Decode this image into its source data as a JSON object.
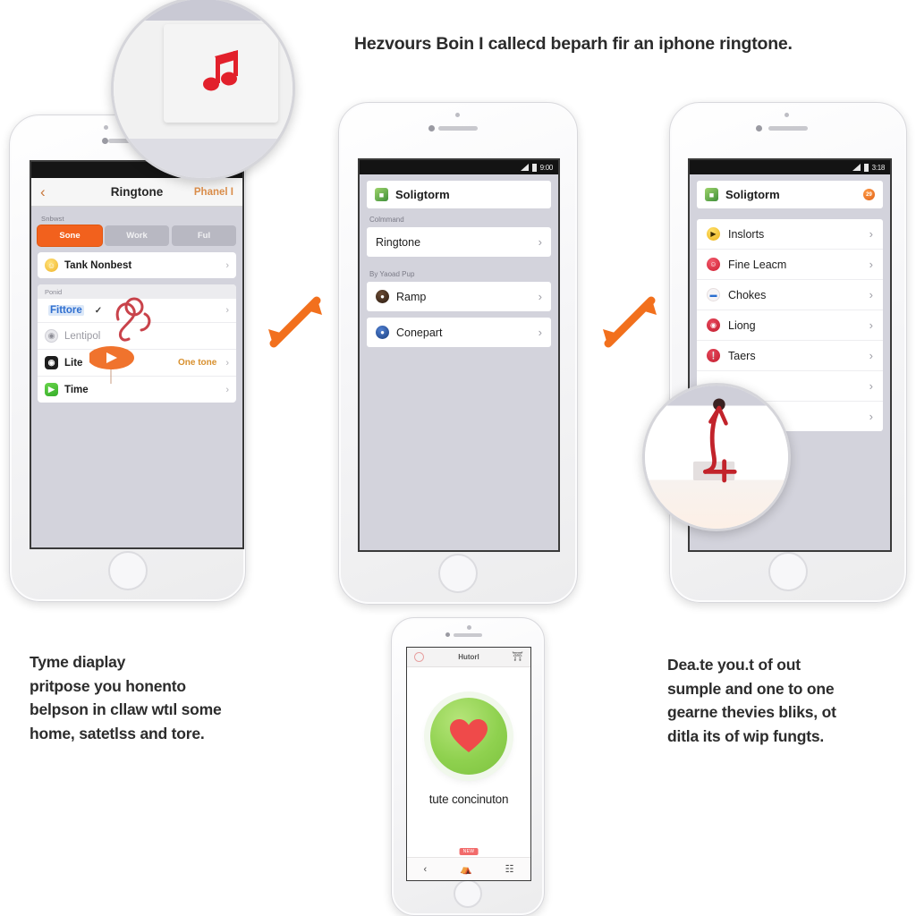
{
  "headline": "Hezvours Boin I callecd beparh fir an iphone ringtone.",
  "phone1": {
    "nav": {
      "back_icon": "chevron-left-icon",
      "title": "Ringtone",
      "action": "Phanel I"
    },
    "group_label": "Snbwst",
    "segments": [
      {
        "label": "Sone",
        "active": true
      },
      {
        "label": "Work",
        "active": false
      },
      {
        "label": "Ful",
        "active": false
      }
    ],
    "top_row": {
      "icon": "smiley-icon",
      "label": "Tank Nonbest",
      "chevron": "›"
    },
    "subhead": "Ponid",
    "rows": [
      {
        "icon": "",
        "label": "Fittore",
        "check": "✓",
        "trail": "",
        "chevron": "›",
        "selected": true
      },
      {
        "icon": "globe-icon",
        "label": "Lentipol",
        "trail": "",
        "chevron": "",
        "muted": true
      },
      {
        "icon": "camera-icon",
        "label": "Lite",
        "trail": "One tone",
        "chevron": "›"
      },
      {
        "icon": "video-icon",
        "label": "Time",
        "trail": "",
        "chevron": "›"
      }
    ]
  },
  "phone2": {
    "statusbar": {
      "signal_icon": "signal-icon",
      "battery_icon": "battery-icon",
      "clock": "9:00"
    },
    "appbar": {
      "icon": "app-icon",
      "title": "Soligtorm"
    },
    "group1_label": "Colmmand",
    "item1": {
      "label": "Ringtone",
      "chevron": "›"
    },
    "group2_label": "By Yaoad Pup",
    "item2": {
      "icon": "avatar-icon",
      "label": "Ramp",
      "chevron": "›"
    },
    "item3": {
      "icon": "shield-icon",
      "label": "Conepart",
      "chevron": "›"
    }
  },
  "phone3": {
    "statusbar": {
      "signal_icon": "signal-icon",
      "battery_icon": "battery-icon",
      "clock": "3:18"
    },
    "appbar": {
      "icon": "app-icon",
      "title": "Soligtorm",
      "badge": "29"
    },
    "rows": [
      {
        "icon": "play-icon",
        "color": "#f2c230",
        "label": "Inslorts",
        "chevron": "›"
      },
      {
        "icon": "smiley-icon",
        "color": "#e03a4e",
        "label": "Fine Leacm",
        "chevron": "›"
      },
      {
        "icon": "chat-icon",
        "color": "#f5f5f8",
        "label": "Chokes",
        "chevron": "›"
      },
      {
        "icon": "record-icon",
        "color": "#d42f3f",
        "label": "Liong",
        "chevron": "›"
      },
      {
        "icon": "info-icon",
        "color": "#d42f3f",
        "label": "Taers",
        "chevron": "›"
      },
      {
        "icon": "",
        "color": "",
        "label": "",
        "chevron": "›"
      },
      {
        "icon": "",
        "color": "",
        "label": "",
        "chevron": "›"
      }
    ]
  },
  "phone4": {
    "topbar": {
      "left_icon": "circle-icon",
      "title": "Hutorl",
      "right_icon": "cart-icon"
    },
    "button": {
      "icon": "heart-icon",
      "bg_color": "#8fd14f",
      "heart_color": "#ef4a4a"
    },
    "caption": "tute concinuton",
    "nav": {
      "badge": "NEW",
      "items": [
        {
          "icon": "chevron-left-icon",
          "glyph": "‹"
        },
        {
          "icon": "bag-icon",
          "glyph": "⛺"
        },
        {
          "icon": "calendar-icon",
          "glyph": "☷"
        }
      ]
    }
  },
  "magnifiers": {
    "music_note": {
      "icon": "music-note-icon",
      "color": "#e2202b"
    },
    "cursor": {
      "icon": "cursor-arrow-icon",
      "color": "#c2232b"
    }
  },
  "arrows": {
    "color": "#f2701d",
    "left": "double-arrow-icon",
    "right": "double-arrow-icon"
  },
  "paragraph_left": [
    "Tyme diaplay",
    "pritpose you honento",
    "belpson in cllaw wtıl some",
    "home, satetlss and tore."
  ],
  "paragraph_right": [
    "Dea.te you.t of out",
    "sumple and one to one",
    "gearne thevies bliks, ot",
    "ditla its of wip fungts."
  ]
}
